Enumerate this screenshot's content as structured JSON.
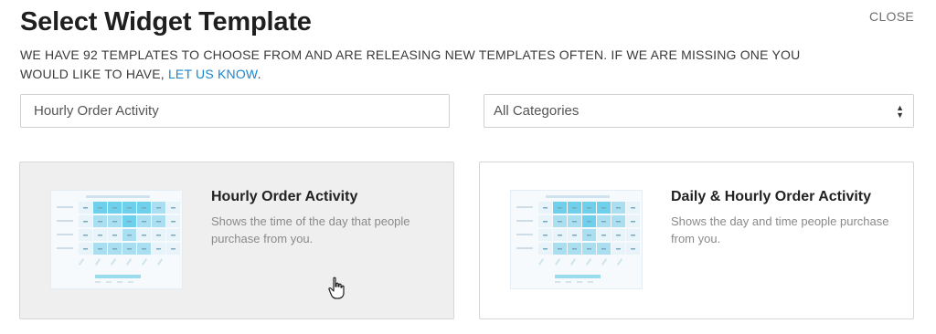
{
  "header": {
    "title": "Select Widget Template",
    "close_label": "CLOSE",
    "intro_text": "WE HAVE 92 TEMPLATES TO CHOOSE FROM AND ARE RELEASING NEW TEMPLATES OFTEN. IF WE ARE MISSING ONE YOU WOULD LIKE TO HAVE,",
    "intro_link": "LET US KNOW",
    "intro_end": "."
  },
  "filters": {
    "search_value": "Hourly Order Activity",
    "category_selected": "All Categories"
  },
  "templates": [
    {
      "title": "Hourly Order Activity",
      "description": "Shows the time of the day that people purchase from you.",
      "selected": true
    },
    {
      "title": "Daily & Hourly Order Activity",
      "description": "Shows the day and time people purchase from you.",
      "selected": false
    }
  ],
  "colors": {
    "link": "#1a86d0",
    "heat_low": "#e8f4fa",
    "heat_mid": "#a9dff0",
    "heat_high": "#6fd0ec",
    "selected_card_bg": "#efefef"
  },
  "icons": {
    "cursor": "hand-pointer-icon",
    "select_arrows": "up-down-arrows-icon"
  }
}
